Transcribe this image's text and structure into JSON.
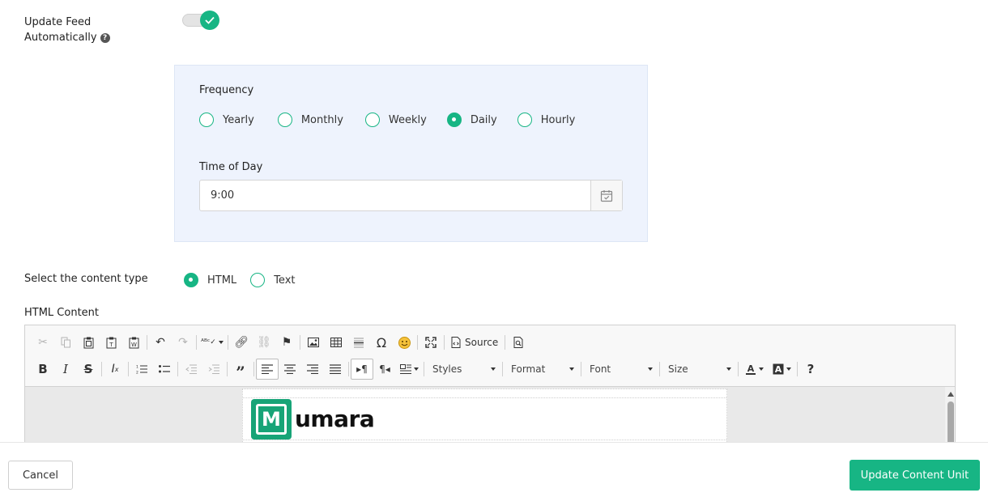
{
  "auto_update": {
    "label_line1": "Update Feed",
    "label_line2": "Automatically",
    "help_icon": "question-circle-icon",
    "enabled": true
  },
  "frequency": {
    "label": "Frequency",
    "options": [
      "Yearly",
      "Monthly",
      "Weekly",
      "Daily",
      "Hourly"
    ],
    "selected": "Daily"
  },
  "time_of_day": {
    "label": "Time of Day",
    "value": "9:00",
    "icon": "calendar-check-icon"
  },
  "content_type": {
    "label": "Select the content type",
    "options": [
      "HTML",
      "Text"
    ],
    "selected": "HTML"
  },
  "html_content": {
    "label": "HTML Content",
    "toolbar": {
      "source_label": "Source",
      "styles_label": "Styles",
      "format_label": "Format",
      "font_label": "Font",
      "size_label": "Size",
      "help_label": "?"
    },
    "document": {
      "logo_letter": "M",
      "logo_text": "umara"
    }
  },
  "footer": {
    "cancel_label": "Cancel",
    "submit_label": "Update Content Unit"
  },
  "colors": {
    "accent": "#17b584",
    "panel_bg": "#eef3fd"
  }
}
